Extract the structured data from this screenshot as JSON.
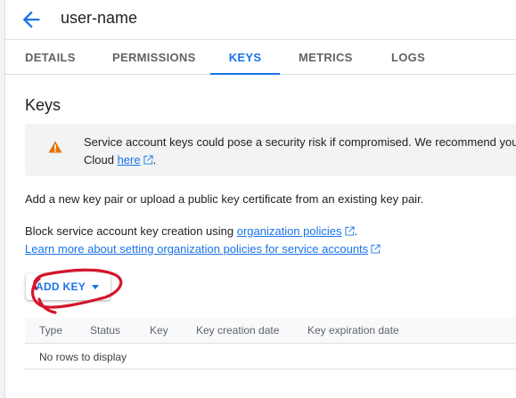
{
  "header": {
    "title": "user-name"
  },
  "tabs": [
    {
      "label": "DETAILS"
    },
    {
      "label": "PERMISSIONS"
    },
    {
      "label": "KEYS"
    },
    {
      "label": "METRICS"
    },
    {
      "label": "LOGS"
    }
  ],
  "active_tab": "KEYS",
  "section": {
    "title": "Keys"
  },
  "warning": {
    "text_line1": "Service account keys could pose a security risk if compromised. We recommend you",
    "text_line2_prefix": "Cloud ",
    "link": "here",
    "text_line2_suffix": "."
  },
  "description": "Add a new key pair or upload a public key certificate from an existing key pair.",
  "block": {
    "prefix": "Block service account key creation using ",
    "link": "organization policies",
    "suffix": "."
  },
  "learn_more": {
    "link": "Learn more about setting organization policies for service accounts"
  },
  "add_key": {
    "label": "ADD KEY"
  },
  "table": {
    "columns": [
      "Type",
      "Status",
      "Key",
      "Key creation date",
      "Key expiration date"
    ],
    "empty": "No rows to display"
  },
  "colors": {
    "accent": "#1a73e8",
    "warning": "#e37400",
    "annotation": "#d3162b"
  }
}
